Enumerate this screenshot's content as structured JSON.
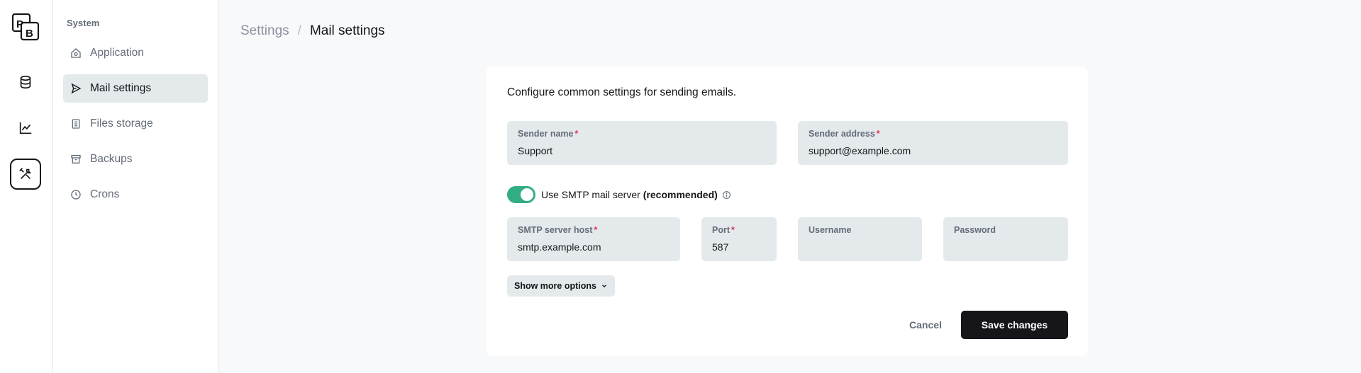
{
  "rail": {
    "logo_letters": [
      "P",
      "B"
    ],
    "items": [
      {
        "icon": "database-icon",
        "active": false
      },
      {
        "icon": "chart-line-icon",
        "active": false
      },
      {
        "icon": "tools-icon",
        "active": true
      }
    ]
  },
  "sidebar": {
    "heading": "System",
    "items": [
      {
        "label": "Application",
        "icon": "home-gear-icon",
        "active": false
      },
      {
        "label": "Mail settings",
        "icon": "send-plane-icon",
        "active": true
      },
      {
        "label": "Files storage",
        "icon": "file-list-icon",
        "active": false
      },
      {
        "label": "Backups",
        "icon": "archive-icon",
        "active": false
      },
      {
        "label": "Crons",
        "icon": "clock-icon",
        "active": false
      }
    ]
  },
  "breadcrumb": {
    "parent": "Settings",
    "separator": "/",
    "current": "Mail settings"
  },
  "form": {
    "intro": "Configure common settings for sending emails.",
    "sender_name": {
      "label": "Sender name",
      "required": "*",
      "value": "Support"
    },
    "sender_address": {
      "label": "Sender address",
      "required": "*",
      "value": "support@example.com"
    },
    "smtp_toggle": {
      "label": "Use SMTP mail server",
      "label_bold": "(recommended)",
      "enabled": true
    },
    "smtp_host": {
      "label": "SMTP server host",
      "required": "*",
      "value": "smtp.example.com"
    },
    "port": {
      "label": "Port",
      "required": "*",
      "value": "587"
    },
    "username": {
      "label": "Username",
      "value": ""
    },
    "password": {
      "label": "Password",
      "value": ""
    },
    "show_more": "Show more options",
    "cancel": "Cancel",
    "save": "Save changes"
  },
  "colors": {
    "accent_dark": "#16161a",
    "toggle_on": "#32ad84",
    "required": "#e13756",
    "field_bg": "#e4e9ec"
  }
}
